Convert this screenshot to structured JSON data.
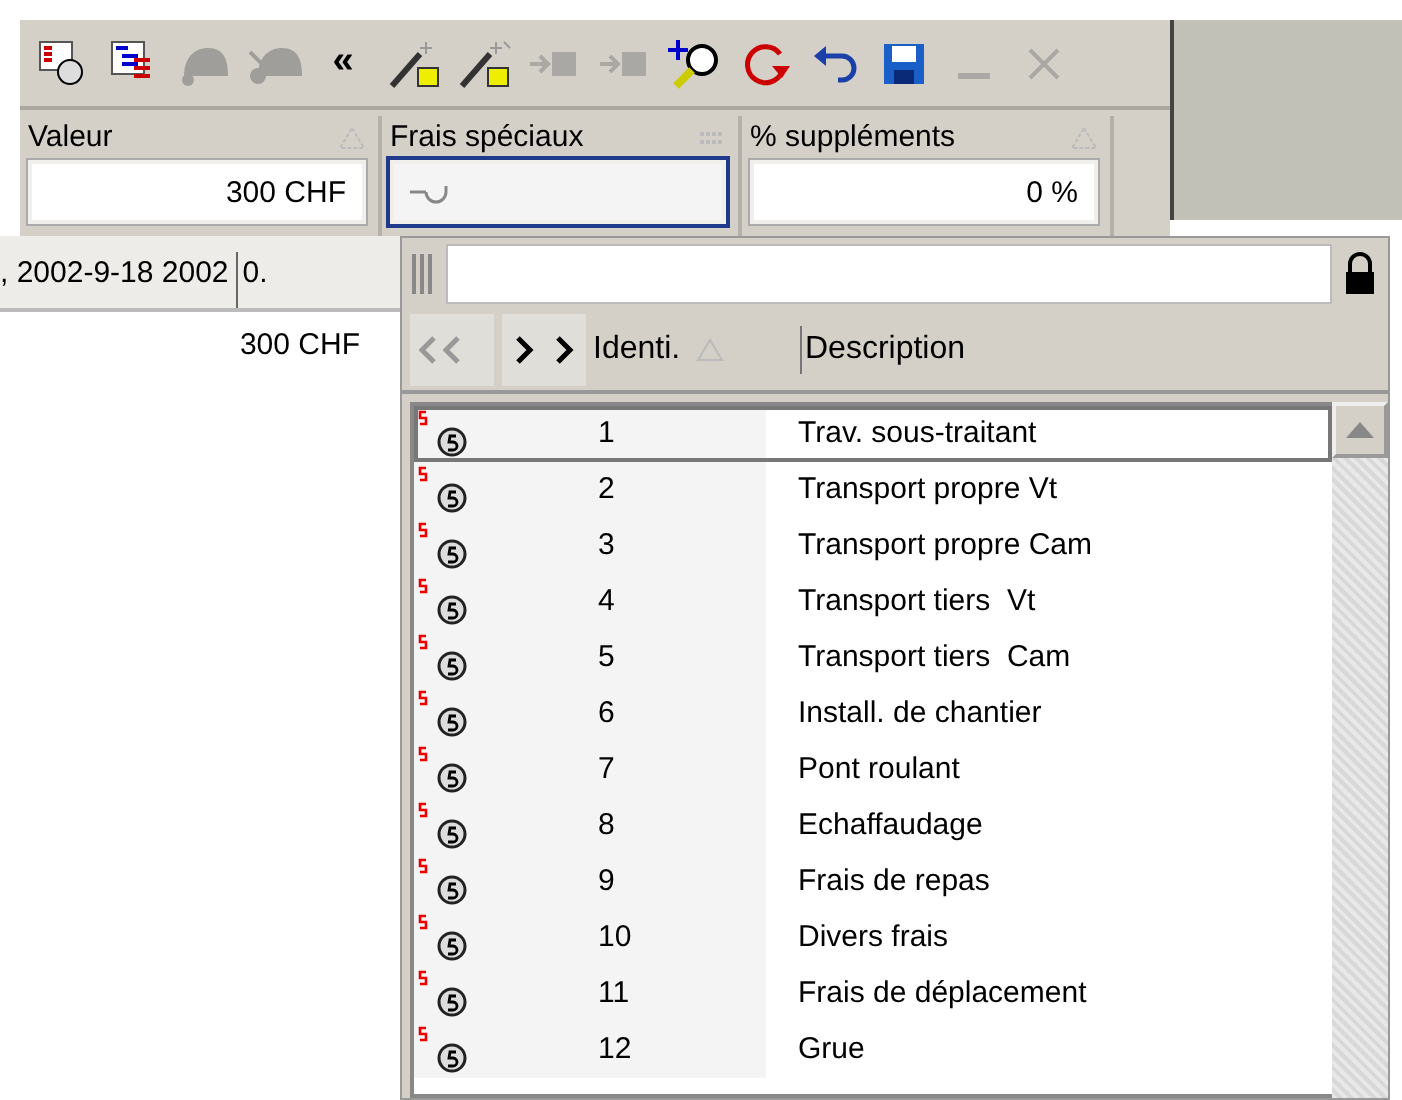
{
  "toolbar": [
    {
      "kind": "report",
      "disabled": false
    },
    {
      "kind": "tree",
      "disabled": false
    },
    {
      "kind": "blob",
      "disabled": true
    },
    {
      "kind": "blob2",
      "disabled": true
    },
    {
      "kind": "text",
      "label": "«",
      "disabled": false
    },
    {
      "kind": "wand",
      "disabled": false
    },
    {
      "kind": "wand2",
      "disabled": false
    },
    {
      "kind": "move",
      "disabled": true
    },
    {
      "kind": "move",
      "disabled": true
    },
    {
      "kind": "search-add",
      "disabled": false
    },
    {
      "kind": "refresh",
      "disabled": false
    },
    {
      "kind": "undo",
      "disabled": false
    },
    {
      "kind": "save",
      "disabled": false
    },
    {
      "kind": "minimize",
      "disabled": true
    },
    {
      "kind": "close",
      "disabled": true
    }
  ],
  "fields": [
    {
      "label": "Valeur",
      "value": "300 CHF",
      "sortable": true,
      "focused": false
    },
    {
      "label": "Frais spéciaux",
      "filterable": true,
      "focused": true,
      "enter_icon": true
    },
    {
      "label": "% suppléments",
      "value": "0 %",
      "sortable": true,
      "focused": false
    }
  ],
  "background_rows": [
    {
      "cells": [
        ", 2002-9-18 2002",
        "0."
      ]
    },
    {
      "cells": [
        "300 CHF"
      ]
    }
  ],
  "lookup": {
    "columns": [
      {
        "label": "Identi.",
        "sortable": true
      },
      {
        "label": "Description",
        "sortable": false
      }
    ],
    "rows": [
      {
        "id": "1",
        "description": "Trav. sous-traitant",
        "selected": true
      },
      {
        "id": "2",
        "description": "Transport propre Vt",
        "selected": false
      },
      {
        "id": "3",
        "description": "Transport propre Cam",
        "selected": false
      },
      {
        "id": "4",
        "description": "Transport tiers  Vt",
        "selected": false
      },
      {
        "id": "5",
        "description": "Transport tiers  Cam",
        "selected": false
      },
      {
        "id": "6",
        "description": "Install. de chantier",
        "selected": false
      },
      {
        "id": "7",
        "description": "Pont roulant",
        "selected": false
      },
      {
        "id": "8",
        "description": "Echaffaudage",
        "selected": false
      },
      {
        "id": "9",
        "description": "Frais de repas",
        "selected": false
      },
      {
        "id": "10",
        "description": "Divers frais",
        "selected": false
      },
      {
        "id": "11",
        "description": "Frais de déplacement",
        "selected": false
      },
      {
        "id": "12",
        "description": "Grue",
        "selected": false
      }
    ]
  }
}
